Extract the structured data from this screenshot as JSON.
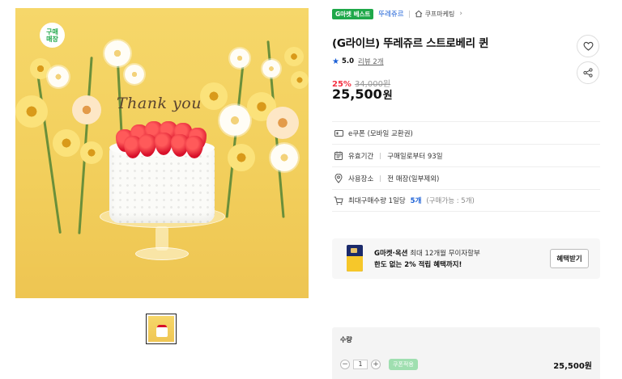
{
  "product_image": {
    "store_badge": "구매\n매장",
    "cake_text": "Thank you"
  },
  "tags": {
    "best": "G마켓 베스트",
    "brand": "뚜레쥬르",
    "shop": "쿠프마케팅"
  },
  "product": {
    "title": "(G라이브) 뚜레쥬르 스트로베리 퀸",
    "rating_score": "5.0",
    "review_link": "리뷰 2개",
    "discount_rate": "25%",
    "original_price": "34,000원",
    "sale_price": "25,500",
    "currency": "원"
  },
  "info": [
    {
      "icon": "coupon-icon",
      "label": "e쿠폰 (모바일 교환권)"
    },
    {
      "icon": "calendar-icon",
      "label": "유효기간",
      "value": "구매일로부터 93일"
    },
    {
      "icon": "location-icon",
      "label": "사용장소",
      "value": "전 매장(일부제외)"
    },
    {
      "icon": "cart-icon",
      "label": "최대구매수량 1일당",
      "value_highlight": "5개",
      "value_note": "(구매가능 : 5개)"
    }
  ],
  "promo": {
    "line1_bold": "G마켓·옥션",
    "line1_rest": " 최대 12개월 무이자할부",
    "line2": "한도 없는 2% 적립 혜택까지!",
    "button": "혜택받기"
  },
  "order": {
    "title": "수량",
    "quantity": "1",
    "coupon_chip": "쿠폰적용",
    "total": "25,500원"
  },
  "colors": {
    "accent_blue": "#1a5fd6",
    "discount_red": "#f43142",
    "best_green": "#1fa84a"
  }
}
